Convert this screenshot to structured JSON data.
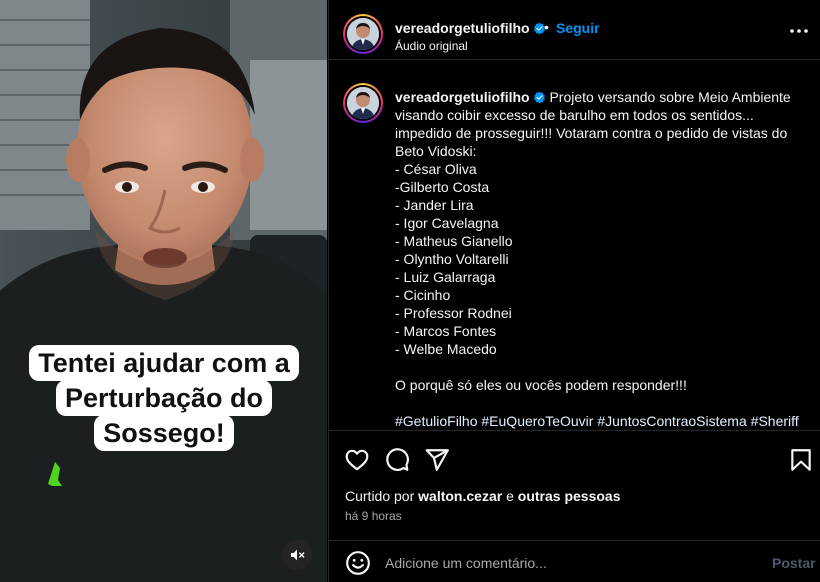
{
  "video": {
    "overlay_lines": [
      "Tentei ajudar com a",
      "Perturbação do",
      "Sossego!"
    ],
    "mute_icon": "speaker-muted-icon"
  },
  "header": {
    "username": "vereadorgetuliofilho",
    "separator": "•",
    "follow_label": "Seguir",
    "audio_label": "Áudio original",
    "more_icon": "more-horizontal-icon"
  },
  "caption": {
    "username": "vereadorgetuliofilho",
    "first_line": "Projeto versando sobre Meio Ambiente",
    "lines": [
      "visando coibir excesso de barulho em todos os sentidos...",
      "impedido de prosseguir!!! Votaram contra o pedido de vistas do",
      "Beto Vidoski:",
      "- César Oliva",
      "-Gilberto Costa",
      "- Jander Lira",
      "- Igor Cavelagna",
      "- Matheus Gianello",
      "- Olyntho Voltarelli",
      "- Luiz Galarraga",
      "- Cicinho",
      "- Professor Rodnei",
      "- Marcos Fontes",
      "- Welbe Macedo"
    ],
    "question": "O porquê só eles ou vocês podem responder!!!",
    "hashtags": [
      "#GetulioFilho",
      "#EuQueroTeOuvir",
      "#JuntosContraoSistema",
      "#Sheriff"
    ]
  },
  "actions": {
    "icons": [
      "heart-icon",
      "comment-icon",
      "share-icon",
      "save-icon"
    ],
    "likes_prefix": "Curtido por",
    "likes_user": "walton.cezar",
    "likes_conj": "e",
    "likes_others": "outras pessoas",
    "time": "há 9 horas"
  },
  "comment": {
    "placeholder": "Adicione um comentário...",
    "post_label": "Postar",
    "emoji_icon": "emoji-icon"
  },
  "colors": {
    "accent_blue": "#0095f6",
    "hashtag": "#e0f1ff",
    "muted_text": "#a8a8a8",
    "post_disabled": "#4d5a6b",
    "border": "#262626"
  }
}
